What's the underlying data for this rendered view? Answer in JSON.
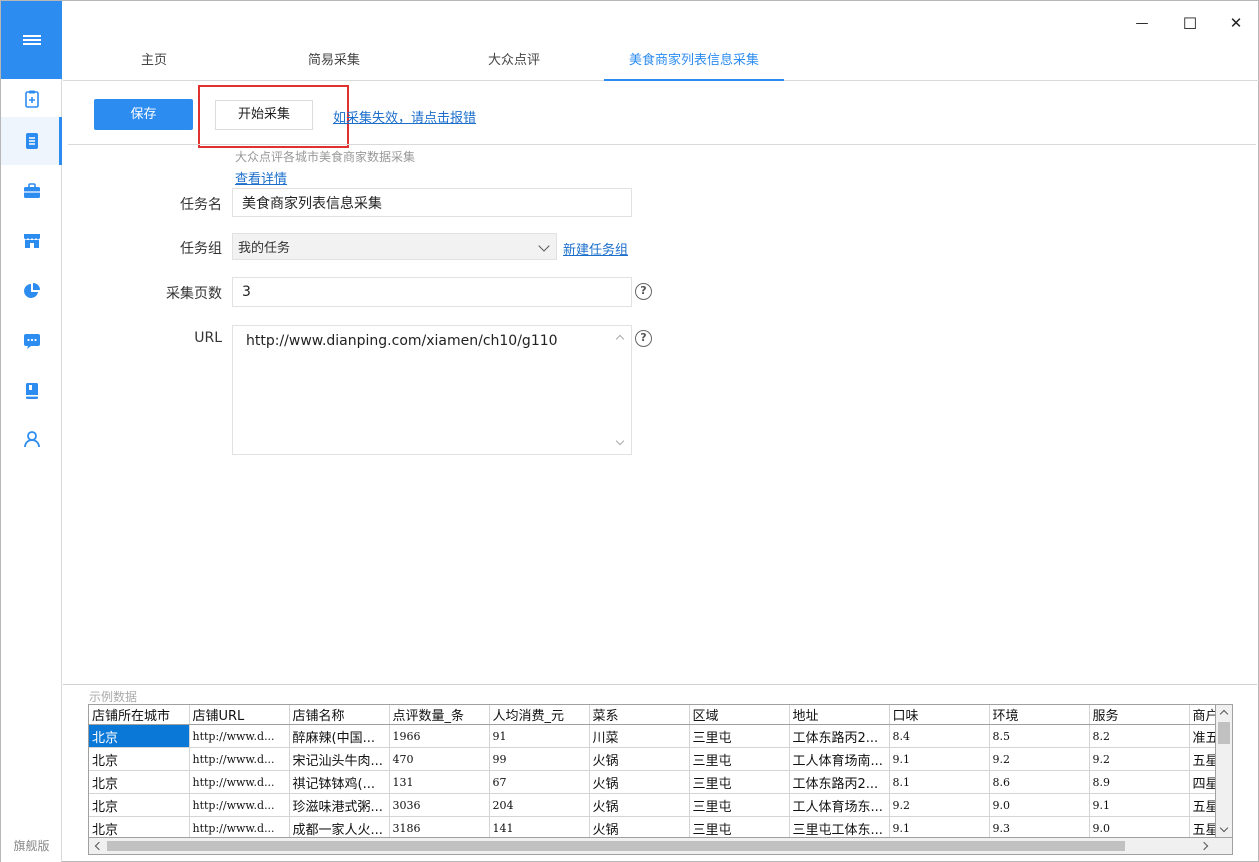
{
  "window": {
    "minimize": "—",
    "maximize": "☐",
    "close": "✕"
  },
  "sidebar": {
    "edition": "旗舰版",
    "icons": [
      "menu-icon",
      "clipboard-add-icon",
      "document-list-icon",
      "briefcase-icon",
      "store-icon",
      "pie-chart-icon",
      "message-icon",
      "book-icon",
      "user-icon"
    ]
  },
  "tabs": [
    {
      "label": "主页"
    },
    {
      "label": "简易采集"
    },
    {
      "label": "大众点评"
    },
    {
      "label": "美食商家列表信息采集"
    }
  ],
  "toolbar": {
    "save_label": "保存",
    "start_label": "开始采集",
    "report_link": "如采集失效，请点击报错"
  },
  "task": {
    "description": "大众点评各城市美食商家数据采集",
    "details_link": "查看详情"
  },
  "form": {
    "name_label": "任务名",
    "name_value": "美食商家列表信息采集",
    "group_label": "任务组",
    "group_value": "我的任务",
    "new_group_link": "新建任务组",
    "pages_label": "采集页数",
    "pages_value": "3",
    "url_label": "URL",
    "url_value": "http://www.dianping.com/xiamen/ch10/g110",
    "help_symbol": "?"
  },
  "sample": {
    "title": "示例数据",
    "columns": [
      "店铺所在城市",
      "店铺URL",
      "店铺名称",
      "点评数量_条",
      "人均消费_元",
      "菜系",
      "区域",
      "地址",
      "口味",
      "环境",
      "服务",
      "商户"
    ],
    "rows": [
      [
        "北京",
        "http://www.d...",
        "醉麻辣(中国...",
        "1966",
        "91",
        "川菜",
        "三里屯",
        "工体东路丙2...",
        "8.4",
        "8.5",
        "8.2",
        "准五"
      ],
      [
        "北京",
        "http://www.d...",
        "宋记汕头牛肉...",
        "470",
        "99",
        "火锅",
        "三里屯",
        "工人体育场南...",
        "9.1",
        "9.2",
        "9.2",
        "五星"
      ],
      [
        "北京",
        "http://www.d...",
        "祺记钵钵鸡(...",
        "131",
        "67",
        "火锅",
        "三里屯",
        "工体东路丙2...",
        "8.1",
        "8.6",
        "8.9",
        "四星"
      ],
      [
        "北京",
        "http://www.d...",
        "珍滋味港式粥...",
        "3036",
        "204",
        "火锅",
        "三里屯",
        "工人体育场东...",
        "9.2",
        "9.0",
        "9.1",
        "五星"
      ],
      [
        "北京",
        "http://www.d...",
        "成都一家人火...",
        "3186",
        "141",
        "火锅",
        "三里屯",
        "三里屯工体东...",
        "9.1",
        "9.3",
        "9.0",
        "五星"
      ]
    ]
  }
}
